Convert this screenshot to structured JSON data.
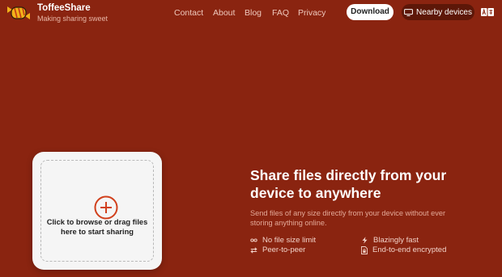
{
  "header": {
    "brand_name": "ToffeeShare",
    "brand_tagline": "Making sharing sweet",
    "nav": [
      {
        "label": "Contact"
      },
      {
        "label": "About"
      },
      {
        "label": "Blog"
      },
      {
        "label": "FAQ"
      },
      {
        "label": "Privacy"
      }
    ],
    "download_label": "Download",
    "nearby_label": "Nearby devices",
    "nearby_icon": "monitor-icon",
    "lang_icon": "translate-icon"
  },
  "dropzone": {
    "icon": "plus-circle-icon",
    "text": "Click to browse or drag files here to start sharing"
  },
  "hero": {
    "title": "Share files directly from your device to anywhere",
    "subtitle": "Send files of any size directly from your device without ever storing anything online."
  },
  "features": [
    {
      "icon": "infinity-icon",
      "label": "No file size limit"
    },
    {
      "icon": "lightning-icon",
      "label": "Blazingly fast"
    },
    {
      "icon": "swap-arrows-icon",
      "label": "Peer-to-peer"
    },
    {
      "icon": "lock-file-icon",
      "label": "End-to-end encrypted"
    }
  ],
  "colors": {
    "background": "#8a2410",
    "accent": "#d1401c",
    "nearby_button": "#5d1708"
  }
}
